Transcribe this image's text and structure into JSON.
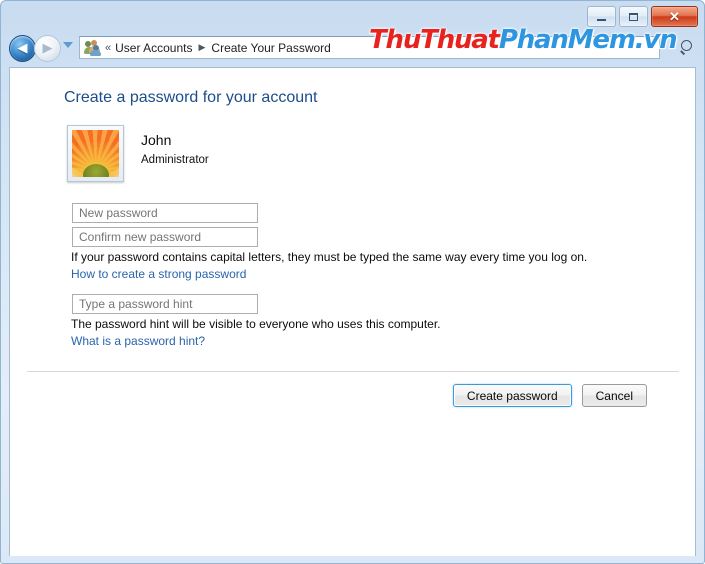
{
  "window": {
    "caption_buttons": {
      "minimize_label": "Minimize",
      "maximize_label": "Maximize",
      "close_label": "✕"
    }
  },
  "navbar": {
    "back_label": "◀",
    "forward_label": "▶",
    "recent_pages_label": "Recent pages",
    "accounts_icon_name": "user-accounts-icon",
    "crumb_overflow": "«",
    "breadcrumb": [
      {
        "label": "User Accounts"
      },
      {
        "label": "Create Your Password"
      }
    ],
    "crumb_separator": "▶",
    "search_label": "Search"
  },
  "watermark": {
    "part_red": "ThuThuat",
    "part_blue": "PhanMem.vn",
    "color_red": "#e8231f",
    "color_blue": "#2e96e0"
  },
  "page": {
    "heading": "Create a password for your account",
    "heading_color": "#1c4e8a"
  },
  "account": {
    "name": "John",
    "role": "Administrator",
    "avatar_name": "flower-avatar"
  },
  "form": {
    "new_password": {
      "placeholder": "New password",
      "value": ""
    },
    "confirm_password": {
      "placeholder": "Confirm new password",
      "value": ""
    },
    "caps_note": "If your password contains capital letters, they must be typed the same way every time you log on.",
    "strong_password_link": "How to create a strong password",
    "password_hint": {
      "placeholder": "Type a password hint",
      "value": ""
    },
    "hint_note": "The password hint will be visible to everyone who uses this computer.",
    "what_is_hint_link": "What is a password hint?"
  },
  "commands": {
    "primary": "Create password",
    "secondary": "Cancel"
  }
}
